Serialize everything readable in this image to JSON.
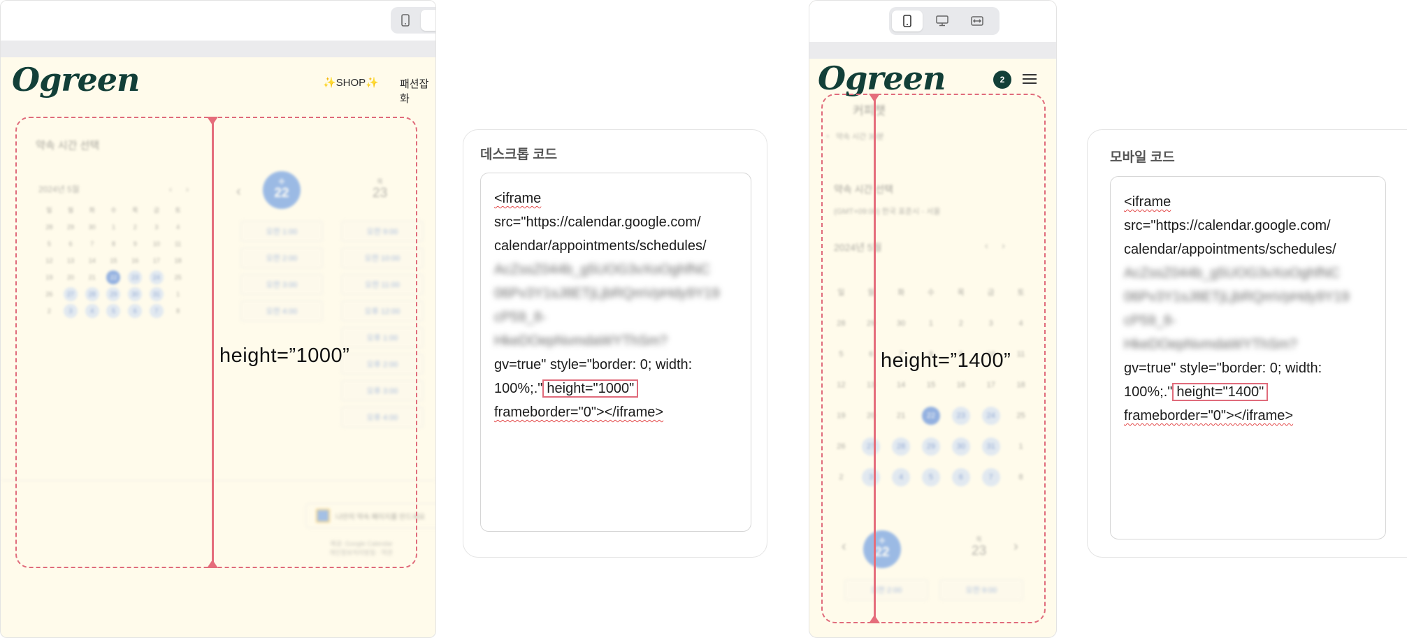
{
  "desktop_preview": {
    "logo": "Ogreen",
    "nav": [
      "✨SHOP✨",
      "패션잡화"
    ],
    "height_label": "height=”1000”",
    "calendar": {
      "section_title": "약속 시간 선택",
      "month": "2024년 5월",
      "weekdays": [
        "일",
        "월",
        "화",
        "수",
        "목",
        "금",
        "토"
      ],
      "rows": [
        [
          "28",
          "29",
          "30",
          "1",
          "2",
          "3",
          "4"
        ],
        [
          "5",
          "6",
          "7",
          "8",
          "9",
          "10",
          "11"
        ],
        [
          "12",
          "13",
          "14",
          "15",
          "16",
          "17",
          "18"
        ],
        [
          "19",
          "20",
          "21",
          "22",
          "23",
          "24",
          "25"
        ],
        [
          "26",
          "27",
          "28",
          "29",
          "30",
          "31",
          "1"
        ],
        [
          "2",
          "3",
          "4",
          "5",
          "6",
          "7",
          "8"
        ]
      ],
      "day_selected": "22",
      "day_selected_label": "수",
      "day_next": "23",
      "day_next_label": "목",
      "slots_left": [
        "오전 1:00",
        "오전 2:00",
        "오전 3:00",
        "오전 4:00"
      ],
      "slots_right": [
        "오전 9:00",
        "오전 10:00",
        "오전 11:00",
        "오후 12:00",
        "오후 1:00",
        "오후 2:00",
        "오후 3:00",
        "오후 4:00"
      ],
      "google_link": "나만의 약속 페이지를 만드세요",
      "footer_1": "제공: Google Calendar",
      "footer_2": "개인정보처리방침 · 약관"
    }
  },
  "desktop_code": {
    "title": "데스크톱 코드",
    "line_1": "<iframe",
    "line_2": "src=\"https://calendar.google.com/",
    "line_3": "calendar/appointments/schedules/",
    "blurred": [
      "AcZssZ044b_g5UOG3vXoOghfNC",
      "06Pv3Y1sJ8ETjLjbRQmVpHdy9Y19",
      "cP59_8-",
      "HkeDOepNvmdaWYThSm?"
    ],
    "line_4": "gv=true\" style=\"border: 0; width:",
    "line_5_pre": "100%;.\"",
    "line_5_hl": "height=\"1000\"",
    "line_6": "frameborder=\"0\"></iframe>"
  },
  "mobile_preview": {
    "logo": "Ogreen",
    "cart_count": "2",
    "height_label": "height=”1400”",
    "blurred_header": "커피챗",
    "blurred_sub": "약속 시간 30분",
    "section_title": "약속 시간 선택",
    "timezone": "(GMT+09:00) 한국 표준시 - 서울",
    "month": "2024년 5월",
    "weekdays": [
      "일",
      "월",
      "화",
      "수",
      "목",
      "금",
      "토"
    ],
    "rows": [
      [
        "28",
        "29",
        "30",
        "1",
        "2",
        "3",
        "4"
      ],
      [
        "5",
        "6",
        "7",
        "8",
        "9",
        "10",
        "11"
      ],
      [
        "12",
        "13",
        "14",
        "15",
        "16",
        "17",
        "18"
      ],
      [
        "19",
        "20",
        "21",
        "22",
        "23",
        "24",
        "25"
      ],
      [
        "26",
        "27",
        "28",
        "29",
        "30",
        "31",
        "1"
      ],
      [
        "2",
        "3",
        "4",
        "5",
        "6",
        "7",
        "8"
      ]
    ],
    "day_selected": "22",
    "day_selected_label": "수",
    "day_next": "23",
    "day_next_label": "목",
    "slot_left": "오전 2:00",
    "slot_right": "오전 9:00"
  },
  "mobile_code": {
    "title": "모바일 코드",
    "line_1": "<iframe",
    "line_2": "src=\"https://calendar.google.com/",
    "line_3": "calendar/appointments/schedules/",
    "blurred": [
      "AcZssZ044b_g5UOG3vXoOghfNC",
      "06Pv3Y1sJ8ETjLjbRQmVpHdy9Y19",
      "cP59_8-",
      "HkeDOepNvmdaWYThSm?"
    ],
    "line_4": "gv=true\" style=\"border: 0; width:",
    "line_5_pre": "100%;.\"",
    "line_5_hl": "height=\"1400\"",
    "line_6": "frameborder=\"0\"></iframe>"
  },
  "colors": {
    "accent_dash": "#e06b7b",
    "logo": "#123f38",
    "page_bg": "#fffbeb",
    "calendar_blue": "#3b74d8"
  }
}
